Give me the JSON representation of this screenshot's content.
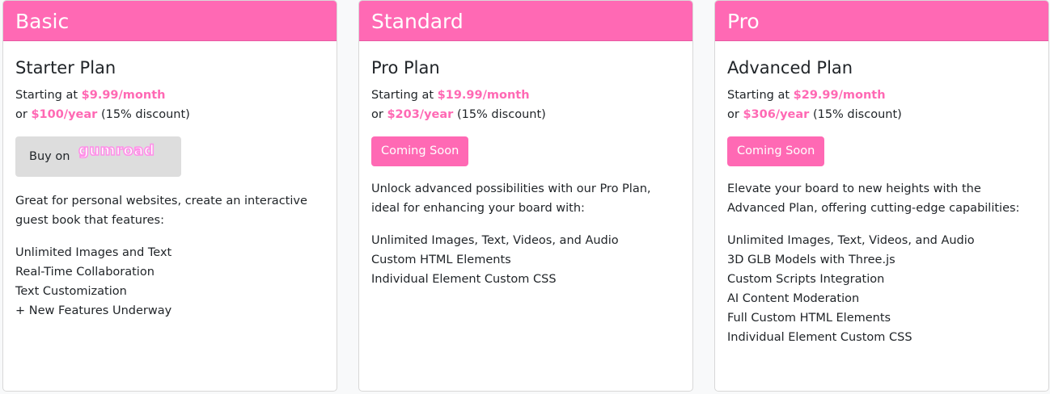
{
  "colors": {
    "accent": "#ff69b4",
    "gumroad_button_bg": "#dddddd"
  },
  "plans": [
    {
      "tier": "Basic",
      "name": "Starter Plan",
      "starting_at": "Starting at",
      "monthly": "$9.99/month",
      "or": "or",
      "yearly": "$100/year",
      "discount": "(15% discount)",
      "button": {
        "prefix": "Buy on",
        "brand": "gumroad"
      },
      "description": "Great for personal websites, create an interactive guest book that features:",
      "features": [
        "Unlimited Images and Text",
        "Real-Time Collaboration",
        "Text Customization",
        "+ New Features Underway"
      ]
    },
    {
      "tier": "Standard",
      "name": "Pro Plan",
      "starting_at": "Starting at",
      "monthly": "$19.99/month",
      "or": "or",
      "yearly": "$203/year",
      "discount": "(15% discount)",
      "button": {
        "label": "Coming Soon"
      },
      "description": "Unlock advanced possibilities with our Pro Plan, ideal for enhancing your board with:",
      "features": [
        "Unlimited Images, Text, Videos, and Audio",
        "Custom HTML Elements",
        "Individual Element Custom CSS"
      ]
    },
    {
      "tier": "Pro",
      "name": "Advanced Plan",
      "starting_at": "Starting at",
      "monthly": "$29.99/month",
      "or": "or",
      "yearly": "$306/year",
      "discount": "(15% discount)",
      "button": {
        "label": "Coming Soon"
      },
      "description": "Elevate your board to new heights with the Advanced Plan, offering cutting-edge capabilities:",
      "features": [
        "Unlimited Images, Text, Videos, and Audio",
        "3D GLB Models with Three.js",
        "Custom Scripts Integration",
        "AI Content Moderation",
        "Full Custom HTML Elements",
        "Individual Element Custom CSS"
      ]
    }
  ]
}
